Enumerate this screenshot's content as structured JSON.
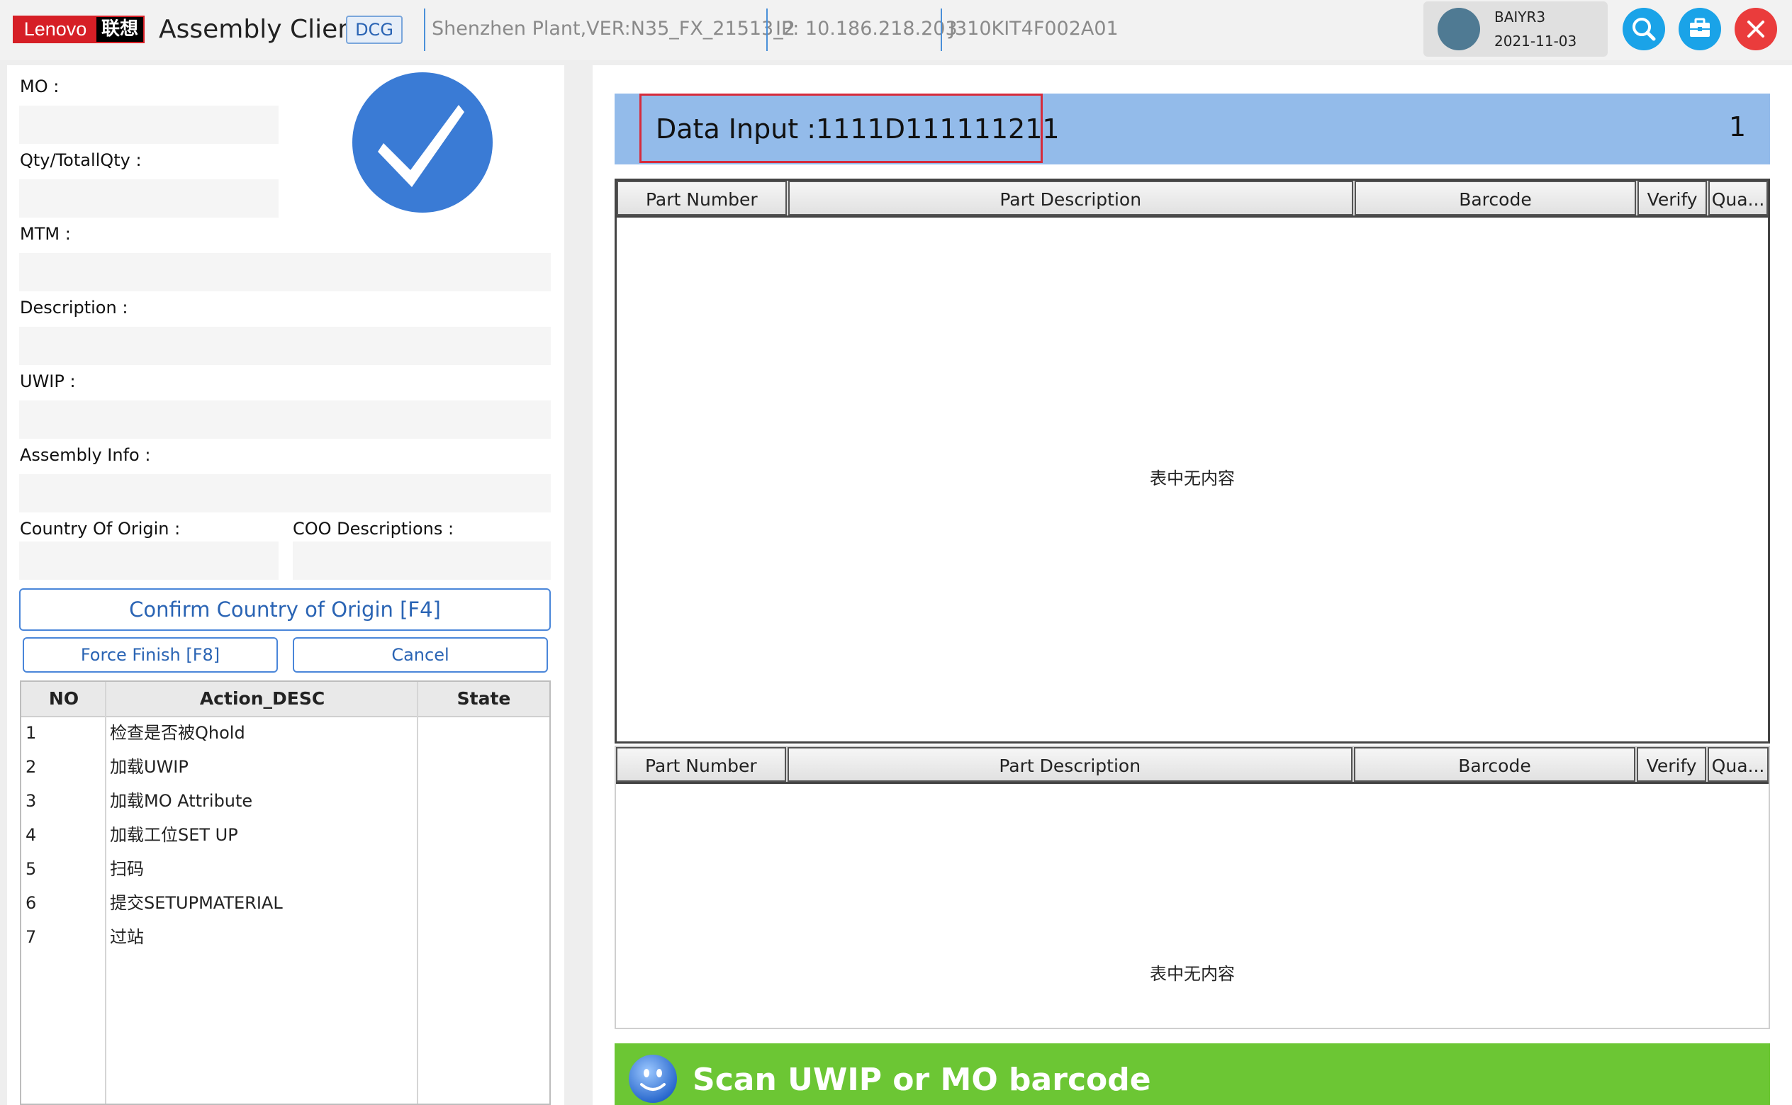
{
  "header": {
    "logo_lenovo": "Lenovo",
    "logo_cn": "联想",
    "app_title": "Assembly Client",
    "badge": "DCG",
    "plant_version": "Shenzhen Plant,VER:N35_FX_21513_2",
    "ip": "IP: 10.186.218.203",
    "station": "J310KIT4F002A01",
    "user_name": "BAIYR3",
    "date": "2021-11-03",
    "icons": [
      "search-icon",
      "briefcase-icon",
      "close-icon"
    ],
    "accent_color": "#1aa3e8",
    "close_color": "#ea3c3c"
  },
  "left": {
    "fields": {
      "mo": {
        "label": "MO :",
        "value": ""
      },
      "qty": {
        "label": "Qty/TotallQty :",
        "value": ""
      },
      "mtm": {
        "label": "MTM :",
        "value": ""
      },
      "description": {
        "label": "Description :",
        "value": ""
      },
      "uwip": {
        "label": "UWIP :",
        "value": ""
      },
      "assembly_info": {
        "label": "Assembly Info :",
        "value": ""
      },
      "country_of_origin": {
        "label": "Country Of Origin :",
        "value": ""
      },
      "coo_descriptions": {
        "label": "COO Descriptions :",
        "value": ""
      }
    },
    "status_icon": "checkmark-circle-icon",
    "confirm_button": "Confirm Country of Origin [F4]",
    "force_finish_button": "Force Finish [F8]",
    "cancel_button": "Cancel",
    "action_table": {
      "headers": [
        "NO",
        "Action_DESC",
        "State"
      ],
      "rows": [
        {
          "no": "1",
          "desc": "检查是否被Qhold",
          "state": ""
        },
        {
          "no": "2",
          "desc": "加载UWIP",
          "state": ""
        },
        {
          "no": "3",
          "desc": "加载MO Attribute",
          "state": ""
        },
        {
          "no": "4",
          "desc": "加载工位SET UP",
          "state": ""
        },
        {
          "no": "5",
          "desc": "扫码",
          "state": ""
        },
        {
          "no": "6",
          "desc": "提交SETUPMATERIAL",
          "state": ""
        },
        {
          "no": "7",
          "desc": "过站",
          "state": ""
        }
      ]
    }
  },
  "right": {
    "data_input": {
      "label": "Data Input :",
      "value": "1111D111111211",
      "count": "1"
    },
    "table_top": {
      "headers": [
        "Part Number",
        "Part Description",
        "Barcode",
        "Verify",
        "Qua..."
      ],
      "empty_text": "表中无内容"
    },
    "table_bottom": {
      "headers": [
        "Part Number",
        "Part Description",
        "Barcode",
        "Verify",
        "Qua..."
      ],
      "empty_text": "表中无内容"
    },
    "status_message": "Scan UWIP or MO barcode",
    "status_icon": "smiley-icon",
    "status_color": "#6cc634"
  }
}
